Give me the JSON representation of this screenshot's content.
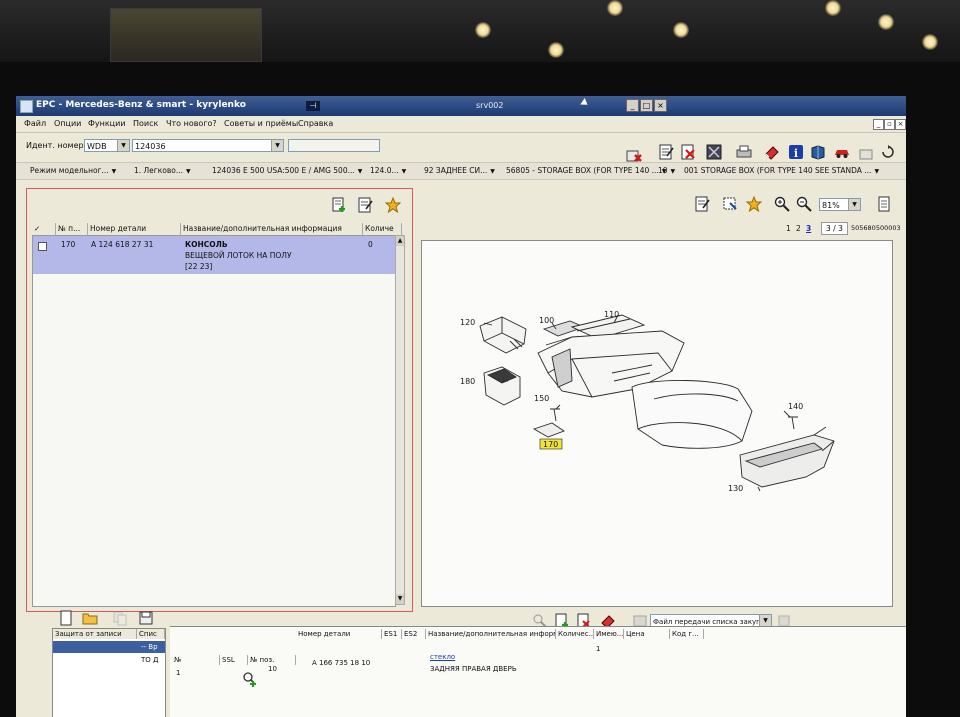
{
  "window": {
    "title": "EPC - Mercedes-Benz & smart - kyrylenko",
    "server": "srv002"
  },
  "menu": [
    "Файл",
    "Опции",
    "Функции",
    "Поиск",
    "Что нового?",
    "Советы и приёмы",
    "Справка"
  ],
  "ident": {
    "label": "Идент. номер",
    "prefix": "WDB",
    "number": "124036",
    "extra": ""
  },
  "breadcrumbs": [
    "Режим модельног...",
    "1. Легково...",
    "124036 E 500 USA:500 E / AMG 500...",
    "124.0...",
    "92 ЗАДНЕЕ СИ...",
    "56805 - STORAGE BOX (FOR TYPE 140 ...",
    "10",
    "001 STORAGE BOX (FOR TYPE 140 SEE STANDA ..."
  ],
  "parts_table": {
    "headers": [
      "✓",
      "№ п...",
      "Номер детали",
      "Название/дополнительная информация",
      "Количе"
    ],
    "rows": [
      {
        "pos": "170",
        "part_no": "A 124 618 27 31",
        "name": "КОНСОЛЬ",
        "info": "ВЕЩЕВОЙ ЛОТОК НА ПОЛУ",
        "ref": "[22 23]",
        "qty": "0"
      }
    ]
  },
  "viewer": {
    "zoom": "81%",
    "pages": [
      "1",
      "2",
      "3"
    ],
    "page_box": "3 / 3",
    "image_code": "505680500003",
    "callouts": [
      "120",
      "100",
      "110",
      "180",
      "150",
      "170",
      "140",
      "130"
    ]
  },
  "bottom": {
    "transfer_label": "Файл передачи списка закупки",
    "left_headers": [
      "Защита от записи",
      "Спис"
    ],
    "left_rows": [
      "-- Вр",
      "ТО Д"
    ],
    "top_headers": [
      "Номер детали",
      "ES1",
      "ES2",
      "Название/дополнительная информ...",
      "Количес...",
      "Имею...",
      "Цена",
      "Код г..."
    ],
    "col_headers": [
      "№",
      "SSL",
      "№ поз."
    ],
    "row": {
      "num": "1",
      "pos": "10",
      "part_no": "A 166 735 18 10",
      "link": "стекло",
      "name": "ЗАДНЯЯ ПРАВАЯ ДВЕРЬ",
      "qty": "1"
    }
  },
  "colors": {
    "titlebar": "#1d3a72",
    "selection": "#b4b8e8",
    "highlight_callout": "#f0e33a",
    "pane_border": "#d45a5a"
  }
}
